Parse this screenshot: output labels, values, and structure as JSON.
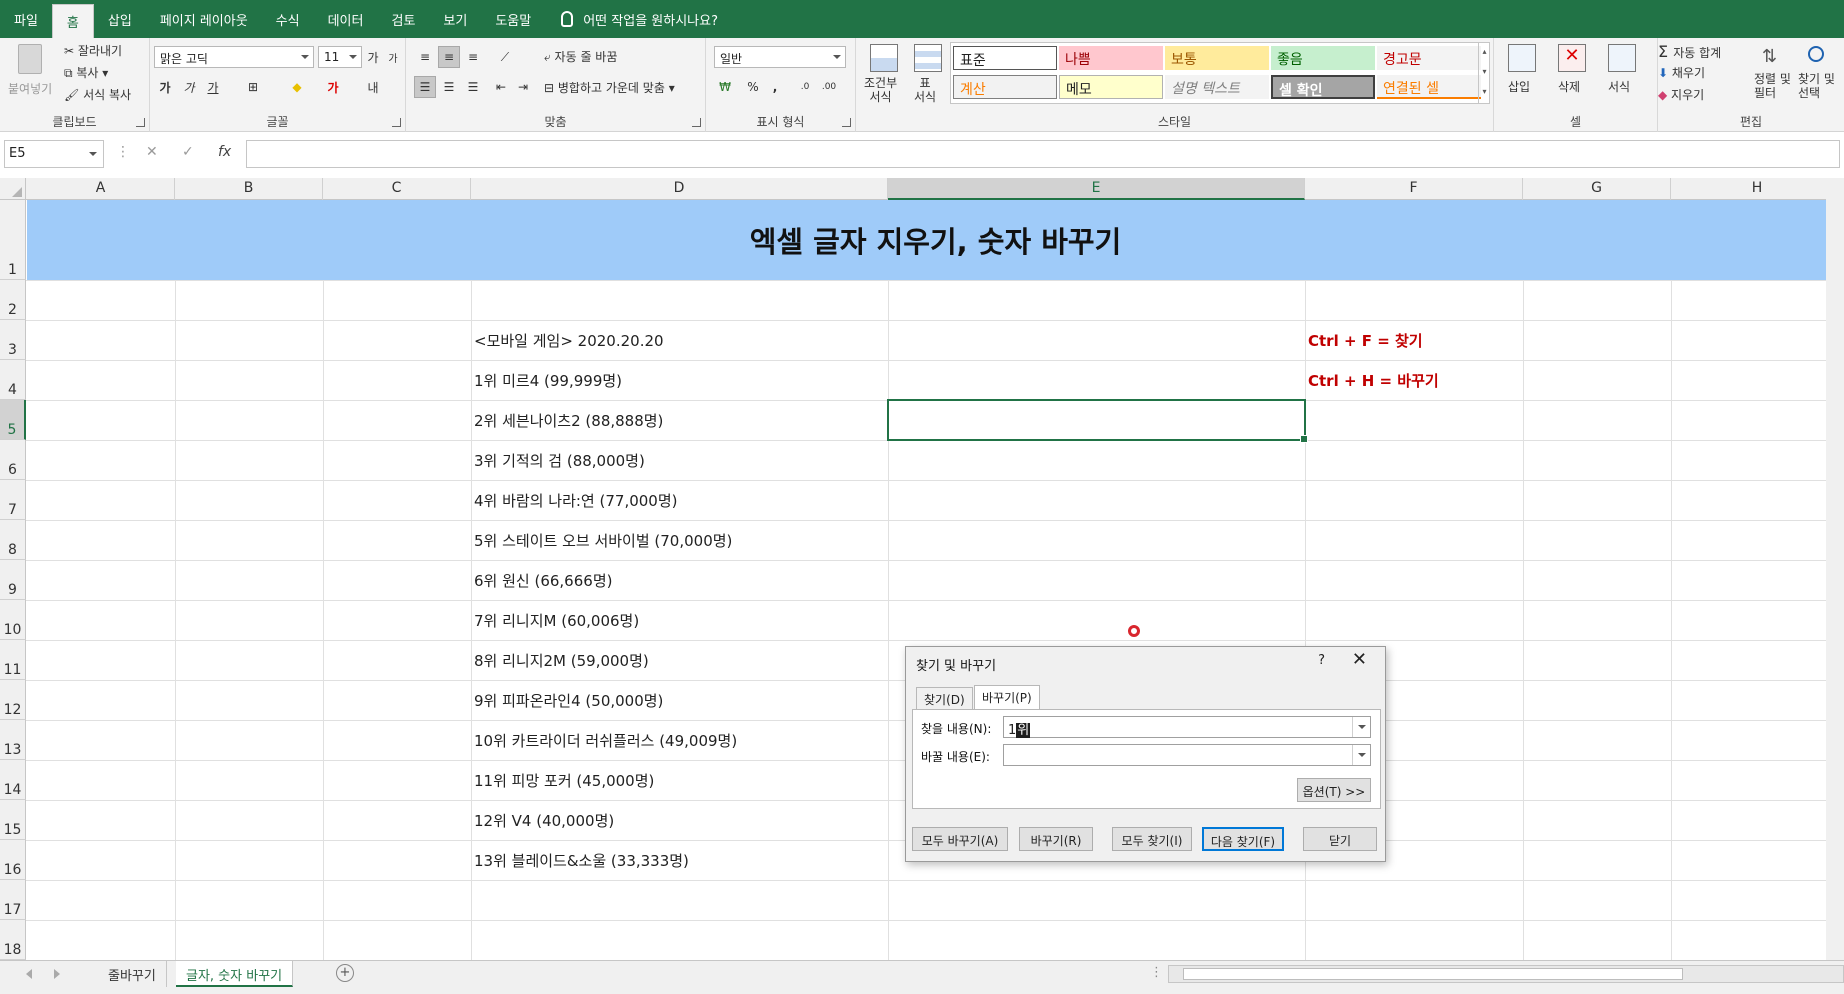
{
  "menu": {
    "tabs": [
      "파일",
      "홈",
      "삽입",
      "페이지 레이아웃",
      "수식",
      "데이터",
      "검토",
      "보기",
      "도움말"
    ],
    "active_index": 1,
    "tell_me": "어떤 작업을 원하시나요?"
  },
  "ribbon": {
    "clipboard": {
      "paste": "붙여넣기",
      "cut": "잘라내기",
      "copy": "복사",
      "format_painter": "서식 복사",
      "label": "클립보드"
    },
    "font": {
      "name": "맑은 고딕",
      "size": "11",
      "bold": "가",
      "italic": "가",
      "underline": "가",
      "label": "글꼴"
    },
    "alignment": {
      "wrap": "자동 줄 바꿈",
      "merge": "병합하고 가운데 맞춤",
      "label": "맞춤"
    },
    "number": {
      "format": "일반",
      "percent": "%",
      "comma": ",",
      "label": "표시 형식"
    },
    "styles": {
      "conditional": "조건부\n서식",
      "table": "표\n서식",
      "cells": [
        {
          "text": "표준",
          "bg": "#ffffff",
          "color": "#222222"
        },
        {
          "text": "나쁨",
          "bg": "#ffc7ce",
          "color": "#9c0006"
        },
        {
          "text": "보통",
          "bg": "#ffeb9c",
          "color": "#9c5700"
        },
        {
          "text": "좋음",
          "bg": "#c6efce",
          "color": "#006100"
        },
        {
          "text": "경고문",
          "bg": "#f3f3f3",
          "color": "#c00000"
        },
        {
          "text": "계산",
          "bg": "#f2f2f2",
          "color": "#fa7d00"
        },
        {
          "text": "메모",
          "bg": "#ffffcc",
          "color": "#222222"
        },
        {
          "text": "설명 텍스트",
          "bg": "#f3f3f3",
          "color": "#7f7f7f"
        },
        {
          "text": "셀 확인",
          "bg": "#a5a5a5",
          "color": "#ffffff"
        },
        {
          "text": "연결된 셀",
          "bg": "#f3f3f3",
          "color": "#fa7d00"
        }
      ],
      "label": "스타일"
    },
    "cells_group": {
      "insert": "삽입",
      "delete": "삭제",
      "format": "서식",
      "label": "셀"
    },
    "editing": {
      "autosum": "자동 합계",
      "fill": "채우기",
      "clear": "지우기",
      "sort": "정렬 및\n필터",
      "find": "찾기 및\n선택",
      "label": "편집"
    }
  },
  "formula_bar": {
    "name_box": "E5",
    "cancel": "✕",
    "enter": "✓",
    "fx": "fx",
    "value": ""
  },
  "sheet": {
    "columns": [
      "A",
      "B",
      "C",
      "D",
      "E",
      "F",
      "G",
      "H"
    ],
    "selected_column": "E",
    "rows": [
      "1",
      "2",
      "3",
      "4",
      "5",
      "6",
      "7",
      "8",
      "9",
      "10",
      "11",
      "12",
      "13",
      "14",
      "15",
      "16",
      "17",
      "18"
    ],
    "selected_row": "5",
    "title": "엑셀 글자 지우기, 숫자 바꾸기",
    "d_cells": [
      "<모바일 게임> 2020.20.20",
      "1위 미르4 (99,999명)",
      "2위 세븐나이츠2 (88,888명)",
      "3위 기적의 검 (88,000명)",
      "4위 바람의 나라:연 (77,000명)",
      "5위 스테이트 오브 서바이벌 (70,000명)",
      "6위 원신 (66,666명)",
      "7위 리니지M (60,006명)",
      "8위 리니지2M (59,000명)",
      "9위 피파온라인4 (50,000명)",
      "10위 카트라이더 러쉬플러스 (49,009명)",
      "11위 피망 포커 (45,000명)",
      "12위 V4 (40,000명)",
      "13위 블레이드&소울 (33,333명)"
    ],
    "shortcuts": [
      "Ctrl + F = 찾기",
      "Ctrl + H = 바꾸기"
    ]
  },
  "dialog": {
    "title": "찾기 및 바꾸기",
    "help": "?",
    "close": "✕",
    "tabs": [
      "찾기(D)",
      "바꾸기(P)"
    ],
    "active_tab": 1,
    "find_label": "찾을 내용(N):",
    "find_value_prefix": "1",
    "find_value_selected": "위",
    "replace_label": "바꿀 내용(E):",
    "replace_value": "",
    "options": "옵션(T) >>",
    "buttons": [
      "모두 바꾸기(A)",
      "바꾸기(R)",
      "모두 찾기(I)",
      "다음 찾기(F)",
      "닫기"
    ]
  },
  "sheet_tabs": {
    "tabs": [
      "줄바꾸기",
      "글자, 숫자 바꾸기"
    ],
    "active_index": 1,
    "add": "+"
  }
}
